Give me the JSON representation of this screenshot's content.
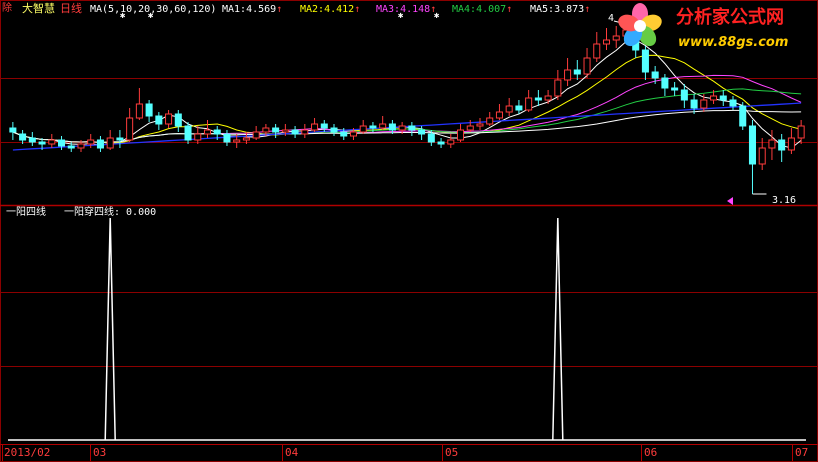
{
  "header": {
    "corner_tag": "除",
    "stock_name": "大智慧",
    "period": "日线",
    "ma_spec": "MA(5,10,20,30,60,120)",
    "ma_values": [
      {
        "label": "MA1:",
        "value": "4.569",
        "color": "#ffffff"
      },
      {
        "label": "MA2:",
        "value": "4.412",
        "color": "#ffff00"
      },
      {
        "label": "MA3:",
        "value": "4.148",
        "color": "#ff44ff"
      },
      {
        "label": "MA4:",
        "value": "4.007",
        "color": "#22cc44"
      },
      {
        "label": "MA5:",
        "value": "3.873",
        "color": "#ffffff"
      }
    ],
    "trend_arrow": "↑",
    "high_label": "4",
    "low_label": "3.16"
  },
  "indicator": {
    "name": "一阳四线",
    "output": "一阳穿四线: 0.000"
  },
  "axis": {
    "ticks": [
      "2013/02",
      "03",
      "04",
      "05",
      "06",
      "07"
    ]
  },
  "watermark": {
    "title": "分析家公式网",
    "url": "www.88gs.com"
  },
  "colors": {
    "grid": "#8b0000",
    "up": "#ff3c3c",
    "down": "#54ffff",
    "ma5": "#ffffff",
    "ma10": "#ffff00",
    "ma20": "#ff44ff",
    "ma30": "#22cc44",
    "ma120": "#2233ff",
    "signal": "#ffffff"
  },
  "chart_data": {
    "type": "candlestick",
    "series_candles": [
      [
        3.82,
        3.78,
        3.88,
        3.7
      ],
      [
        3.76,
        3.7,
        3.8,
        3.66
      ],
      [
        3.72,
        3.68,
        3.78,
        3.64
      ],
      [
        3.68,
        3.66,
        3.72,
        3.6
      ],
      [
        3.66,
        3.7,
        3.76,
        3.62
      ],
      [
        3.7,
        3.64,
        3.74,
        3.6
      ],
      [
        3.64,
        3.62,
        3.68,
        3.58
      ],
      [
        3.62,
        3.66,
        3.7,
        3.58
      ],
      [
        3.66,
        3.7,
        3.76,
        3.62
      ],
      [
        3.7,
        3.62,
        3.74,
        3.58
      ],
      [
        3.62,
        3.72,
        3.8,
        3.6
      ],
      [
        3.72,
        3.7,
        3.8,
        3.62
      ],
      [
        3.7,
        3.92,
        4.02,
        3.68
      ],
      [
        3.92,
        4.06,
        4.22,
        3.9
      ],
      [
        4.06,
        3.94,
        4.1,
        3.88
      ],
      [
        3.94,
        3.86,
        3.98,
        3.8
      ],
      [
        3.86,
        3.96,
        4.0,
        3.82
      ],
      [
        3.96,
        3.84,
        4.0,
        3.78
      ],
      [
        3.84,
        3.7,
        3.88,
        3.66
      ],
      [
        3.7,
        3.76,
        3.84,
        3.66
      ],
      [
        3.76,
        3.8,
        3.9,
        3.72
      ],
      [
        3.8,
        3.76,
        3.84,
        3.7
      ],
      [
        3.76,
        3.68,
        3.8,
        3.64
      ],
      [
        3.68,
        3.7,
        3.76,
        3.62
      ],
      [
        3.7,
        3.72,
        3.78,
        3.66
      ],
      [
        3.72,
        3.78,
        3.84,
        3.7
      ],
      [
        3.78,
        3.82,
        3.86,
        3.74
      ],
      [
        3.82,
        3.78,
        3.86,
        3.72
      ],
      [
        3.78,
        3.8,
        3.86,
        3.74
      ],
      [
        3.8,
        3.76,
        3.84,
        3.72
      ],
      [
        3.76,
        3.8,
        3.86,
        3.72
      ],
      [
        3.8,
        3.86,
        3.92,
        3.78
      ],
      [
        3.86,
        3.82,
        3.9,
        3.78
      ],
      [
        3.82,
        3.78,
        3.86,
        3.74
      ],
      [
        3.78,
        3.74,
        3.82,
        3.7
      ],
      [
        3.74,
        3.78,
        3.82,
        3.7
      ],
      [
        3.78,
        3.84,
        3.9,
        3.76
      ],
      [
        3.84,
        3.82,
        3.88,
        3.78
      ],
      [
        3.82,
        3.86,
        3.94,
        3.8
      ],
      [
        3.86,
        3.8,
        3.9,
        3.76
      ],
      [
        3.8,
        3.84,
        3.88,
        3.76
      ],
      [
        3.84,
        3.8,
        3.88,
        3.74
      ],
      [
        3.8,
        3.76,
        3.84,
        3.7
      ],
      [
        3.76,
        3.68,
        3.8,
        3.64
      ],
      [
        3.68,
        3.66,
        3.72,
        3.62
      ],
      [
        3.66,
        3.7,
        3.76,
        3.62
      ],
      [
        3.7,
        3.8,
        3.86,
        3.68
      ],
      [
        3.8,
        3.84,
        3.9,
        3.78
      ],
      [
        3.84,
        3.86,
        3.92,
        3.8
      ],
      [
        3.86,
        3.92,
        3.98,
        3.84
      ],
      [
        3.92,
        3.98,
        4.06,
        3.9
      ],
      [
        3.98,
        4.04,
        4.12,
        3.94
      ],
      [
        4.04,
        4.0,
        4.1,
        3.96
      ],
      [
        4.0,
        4.12,
        4.2,
        3.98
      ],
      [
        4.12,
        4.1,
        4.2,
        4.04
      ],
      [
        4.1,
        4.14,
        4.2,
        4.06
      ],
      [
        4.14,
        4.3,
        4.4,
        4.1
      ],
      [
        4.3,
        4.4,
        4.52,
        4.24
      ],
      [
        4.4,
        4.36,
        4.5,
        4.3
      ],
      [
        4.36,
        4.52,
        4.62,
        4.32
      ],
      [
        4.52,
        4.66,
        4.78,
        4.48
      ],
      [
        4.66,
        4.7,
        4.82,
        4.6
      ],
      [
        4.7,
        4.74,
        4.84,
        4.62
      ],
      [
        4.74,
        4.8,
        4.86,
        4.7
      ],
      [
        4.8,
        4.6,
        4.82,
        4.52
      ],
      [
        4.6,
        4.38,
        4.64,
        4.3
      ],
      [
        4.38,
        4.32,
        4.44,
        4.26
      ],
      [
        4.32,
        4.22,
        4.36,
        4.14
      ],
      [
        4.22,
        4.2,
        4.28,
        4.14
      ],
      [
        4.2,
        4.1,
        4.26,
        4.02
      ],
      [
        4.1,
        4.02,
        4.16,
        3.96
      ],
      [
        4.02,
        4.1,
        4.16,
        3.98
      ],
      [
        4.1,
        4.14,
        4.2,
        4.06
      ],
      [
        4.14,
        4.1,
        4.2,
        4.04
      ],
      [
        4.1,
        4.04,
        4.14,
        4.0
      ],
      [
        4.04,
        3.84,
        4.08,
        3.8
      ],
      [
        3.84,
        3.46,
        3.9,
        3.16
      ],
      [
        3.46,
        3.62,
        3.72,
        3.4
      ],
      [
        3.62,
        3.7,
        3.8,
        3.5
      ],
      [
        3.7,
        3.6,
        3.76,
        3.48
      ],
      [
        3.6,
        3.72,
        3.82,
        3.56
      ],
      [
        3.72,
        3.84,
        3.9,
        3.66
      ]
    ],
    "signal_peaks_at_index": [
      10,
      56
    ],
    "x_tick_labels": [
      "2013/02",
      "03",
      "04",
      "05",
      "06",
      "07"
    ],
    "price_high_marker": 4.86,
    "price_low_marker": 3.16,
    "ylim_price": [
      3.1,
      4.92
    ],
    "ylim_signal": [
      0,
      1
    ]
  }
}
